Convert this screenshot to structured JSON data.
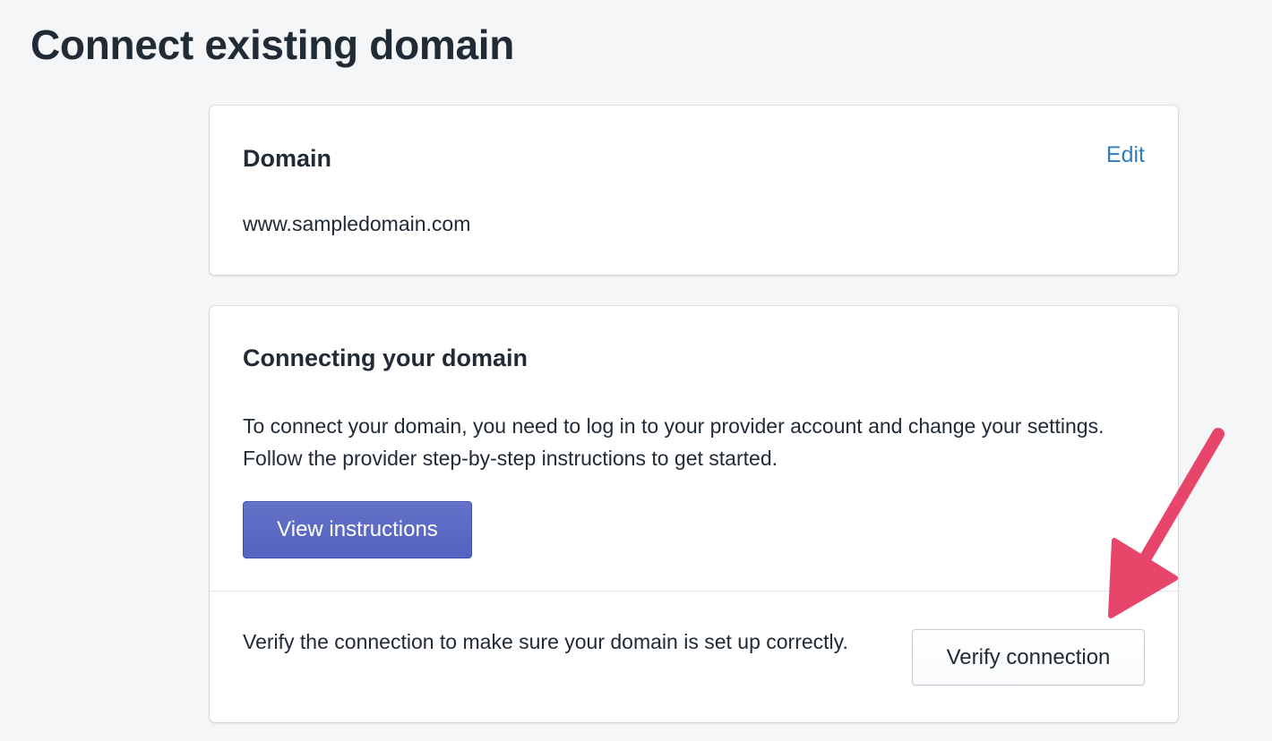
{
  "page": {
    "title": "Connect existing domain"
  },
  "domain_card": {
    "title": "Domain",
    "edit_label": "Edit",
    "domain_value": "www.sampledomain.com"
  },
  "connect_card": {
    "title": "Connecting your domain",
    "description": "To connect your domain, you need to log in to your provider account and change your settings. Follow the provider step-by-step instructions to get started.",
    "view_instructions_label": "View instructions",
    "verify_text": "Verify the connection to make sure your domain is set up correctly.",
    "verify_button_label": "Verify connection"
  },
  "colors": {
    "background": "#f4f6f8",
    "primary_button": "#5c6ac4",
    "link": "#2d7fc0",
    "annotation_arrow": "#e8456b"
  },
  "icons": {
    "annotation": "arrow-pointer-icon"
  }
}
